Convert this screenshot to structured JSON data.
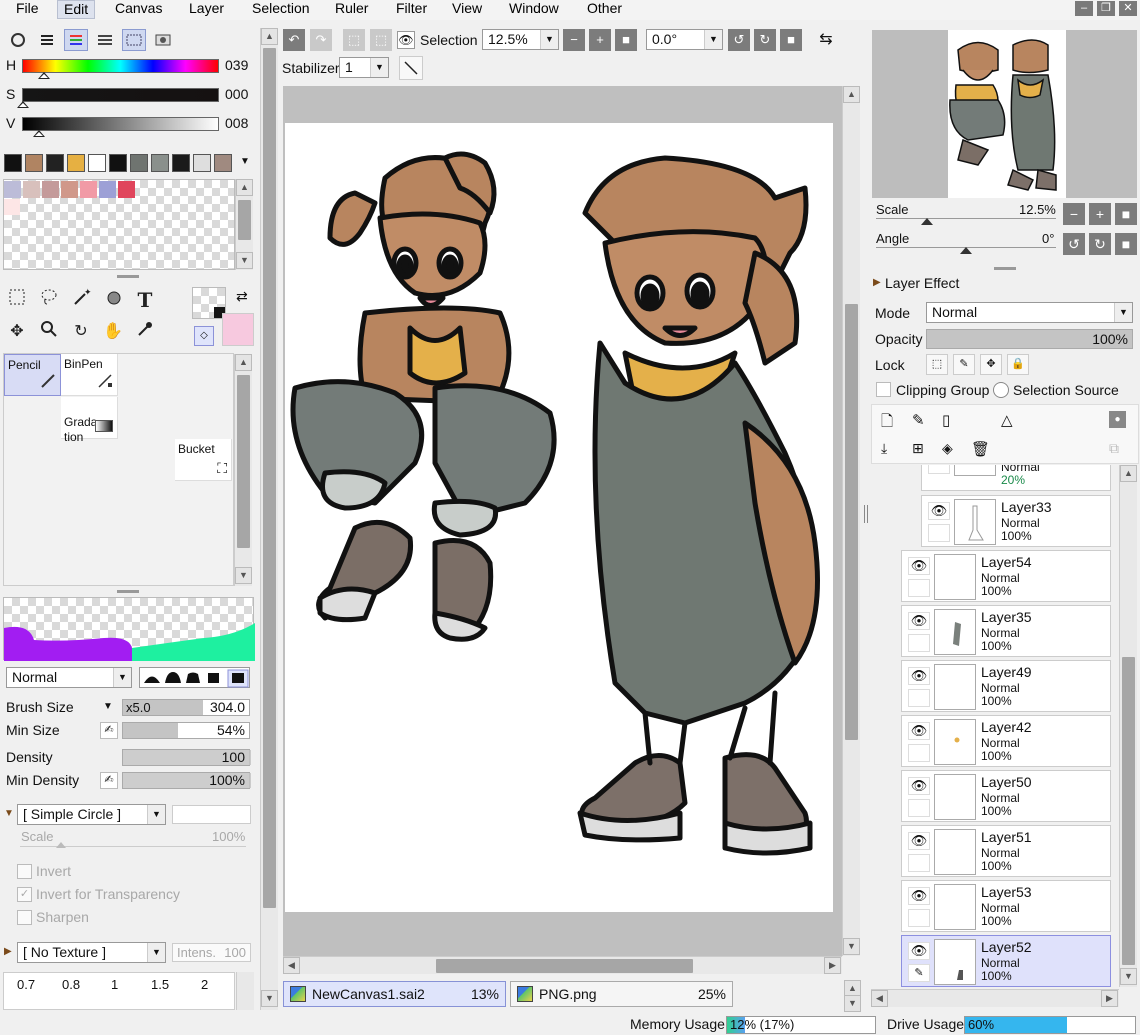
{
  "menu": [
    "File",
    "Edit",
    "Canvas",
    "Layer",
    "Selection",
    "Ruler",
    "Filter",
    "View",
    "Window",
    "Other"
  ],
  "menu_active": "Edit",
  "color": {
    "h_label": "H",
    "h_value": "039",
    "s_label": "S",
    "s_value": "000",
    "v_label": "V",
    "v_value": "008",
    "h_level": 0.11,
    "s_level": 0.0,
    "v_level": 0.08
  },
  "swatches": [
    "#111111",
    "#b08462",
    "#222222",
    "#e6b042",
    "#ffffff",
    "#111111",
    "#6f7470",
    "#8a908c",
    "#1a1a1a",
    "#dedede",
    "#a08a80"
  ],
  "palette": [
    "#bcbcd8",
    "#d8c0bc",
    "#c49a9a",
    "#d0988a",
    "#f19aa6",
    "#9da0d6",
    "#e0455c"
  ],
  "brushes": [
    {
      "label": "Pencil"
    },
    {
      "label": "BinPen"
    },
    {
      "label": "Grada-\ntion"
    },
    {
      "label": "Bucket"
    }
  ],
  "brush_mode": "Normal",
  "brush_props": {
    "size_label": "Brush Size",
    "size_mult": "x5.0",
    "size_value": "304.0",
    "min_size_label": "Min Size",
    "min_size_value": "54%",
    "density_label": "Density",
    "density_value": "100",
    "min_density_label": "Min Density",
    "min_density_value": "100%"
  },
  "shape": {
    "shape_name": "[ Simple Circle ]",
    "scale_label": "Scale",
    "scale_value": "100%",
    "invert_label": "Invert",
    "invert_trans_label": "Invert for Transparency",
    "sharpen_label": "Sharpen",
    "texture_name": "[ No Texture ]",
    "intens_label": "Intens.",
    "intens_value": "100"
  },
  "size_presets": [
    "0.7",
    "0.8",
    "1",
    "1.5",
    "2"
  ],
  "toolbar": {
    "selection_label": "Selection",
    "zoom": "12.5%",
    "angle": "0.0°",
    "stabilizer_label": "Stabilizer",
    "stabilizer_value": "1"
  },
  "tabs": [
    {
      "name": "NewCanvas1.sai2",
      "pct": "13%"
    },
    {
      "name": "PNG.png",
      "pct": "25%"
    }
  ],
  "navigator": {
    "scale_label": "Scale",
    "scale_value": "12.5%",
    "angle_label": "Angle",
    "angle_value": "0°"
  },
  "layer_panel": {
    "effect_label": "Layer Effect",
    "mode_label": "Mode",
    "mode_value": "Normal",
    "opacity_label": "Opacity",
    "opacity_value": "100%",
    "lock_label": "Lock",
    "clipping_label": "Clipping Group",
    "selection_source_label": "Selection Source"
  },
  "layers": [
    {
      "name": "",
      "mode": "Normal",
      "opacity": "20%"
    },
    {
      "name": "Layer33",
      "mode": "Normal",
      "opacity": "100%"
    },
    {
      "name": "Layer54",
      "mode": "Normal",
      "opacity": "100%"
    },
    {
      "name": "Layer35",
      "mode": "Normal",
      "opacity": "100%"
    },
    {
      "name": "Layer49",
      "mode": "Normal",
      "opacity": "100%"
    },
    {
      "name": "Layer42",
      "mode": "Normal",
      "opacity": "100%"
    },
    {
      "name": "Layer50",
      "mode": "Normal",
      "opacity": "100%"
    },
    {
      "name": "Layer51",
      "mode": "Normal",
      "opacity": "100%"
    },
    {
      "name": "Layer53",
      "mode": "Normal",
      "opacity": "100%"
    },
    {
      "name": "Layer52",
      "mode": "Normal",
      "opacity": "100%"
    }
  ],
  "status": {
    "memory_label": "Memory Usage",
    "memory_value": "12% (17%)",
    "drive_label": "Drive Usage",
    "drive_value": "60%",
    "memory_level": 0.12,
    "drive_level": 0.6
  }
}
